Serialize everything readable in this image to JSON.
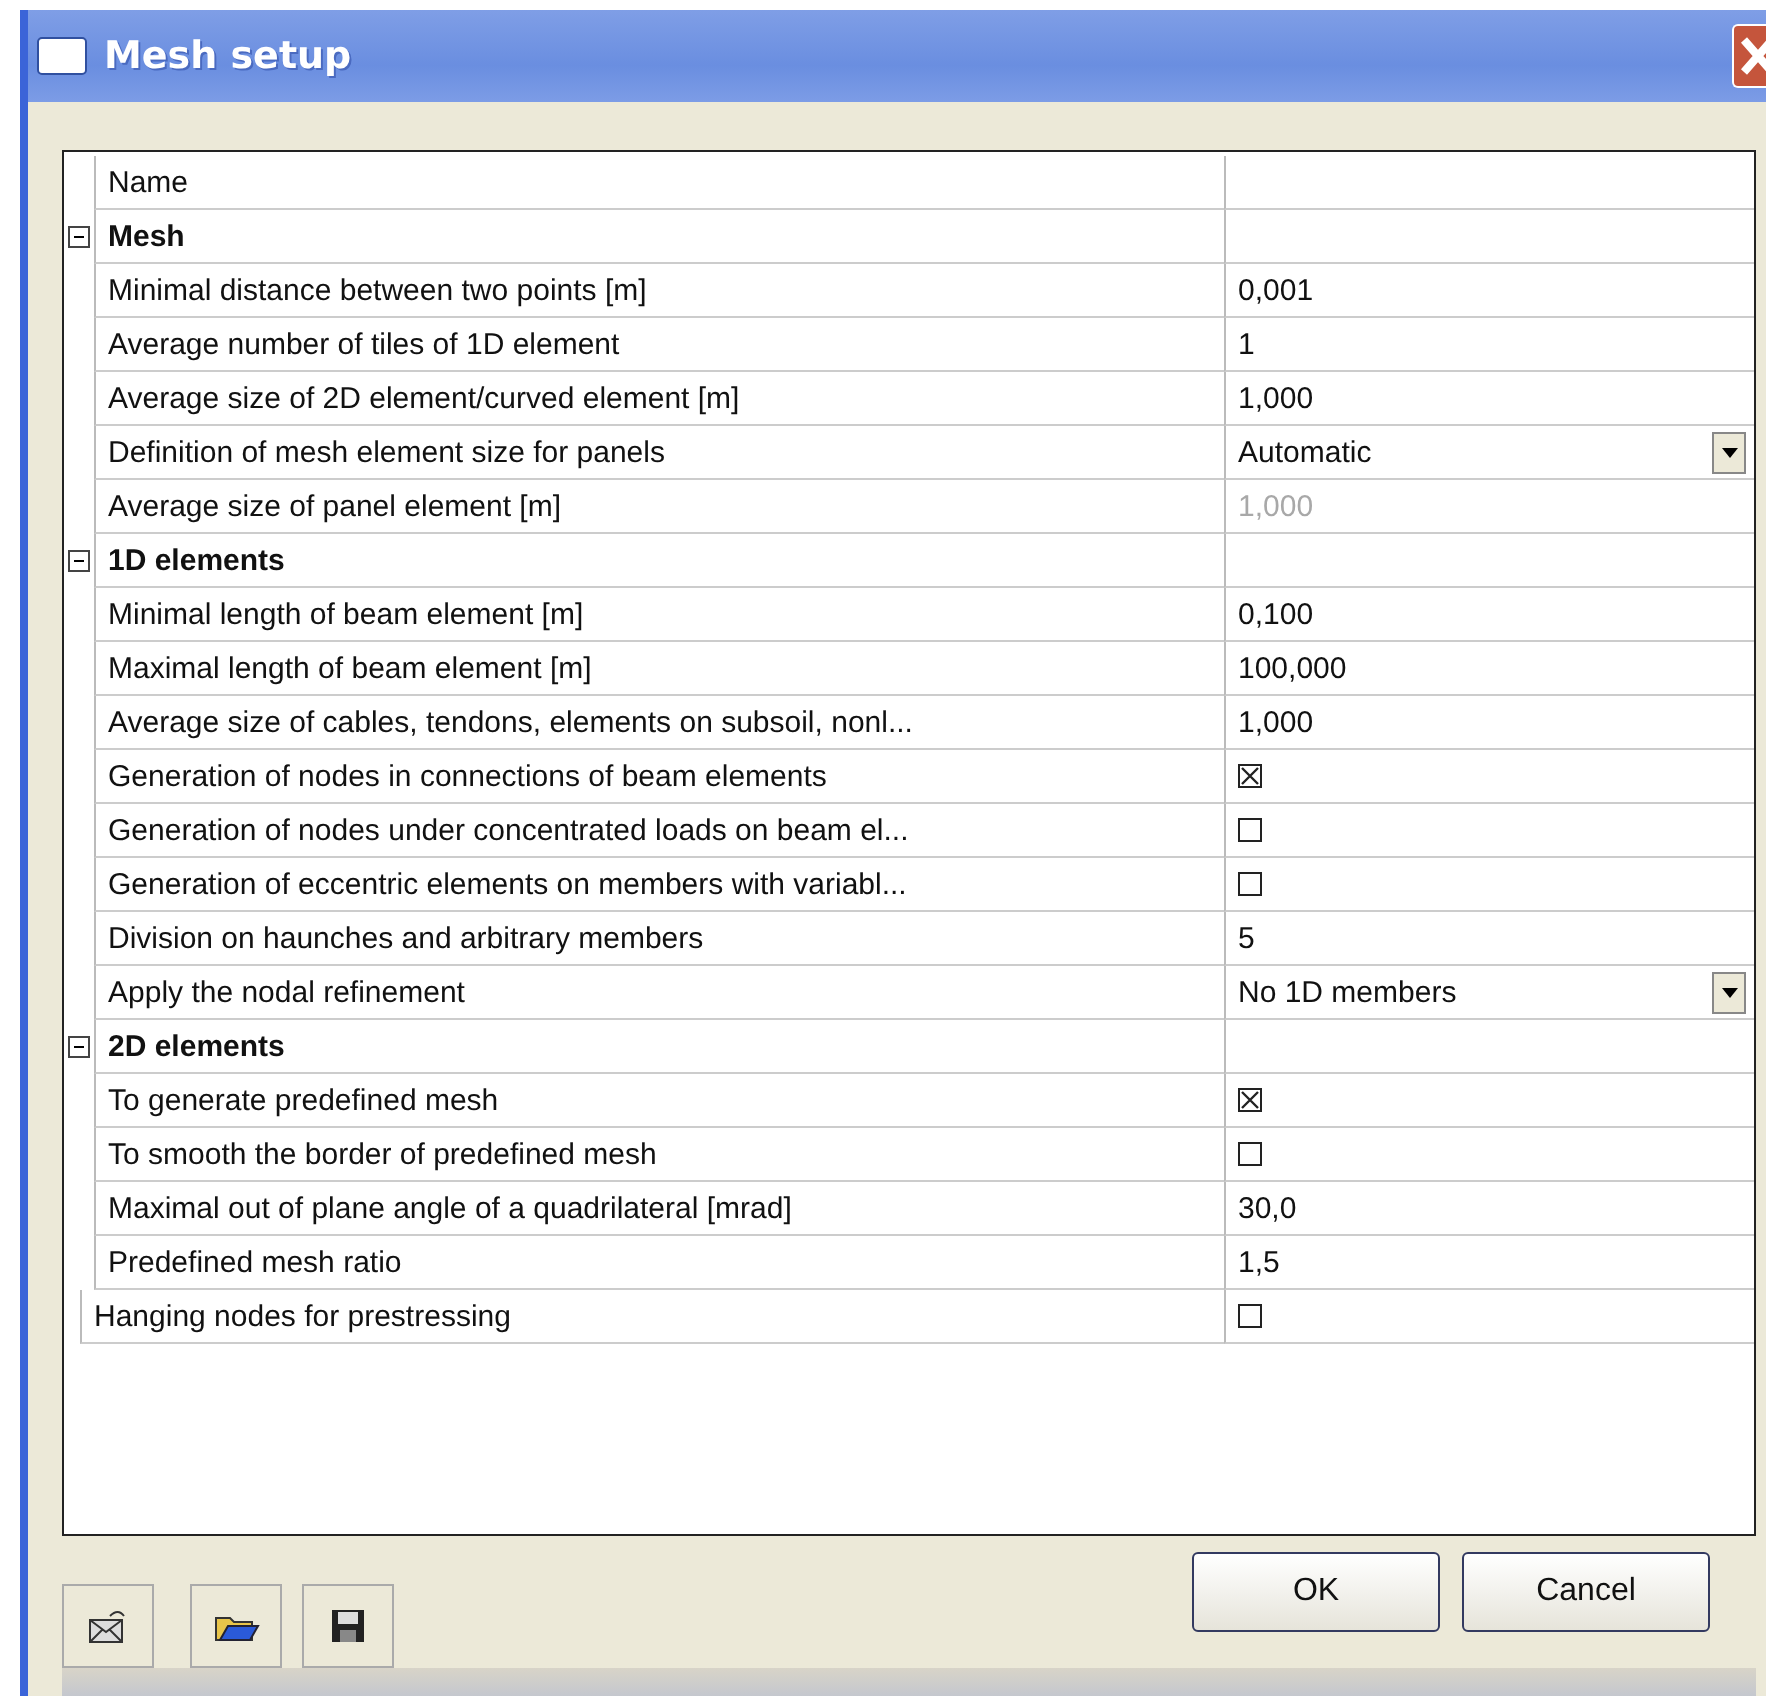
{
  "window": {
    "title": "Mesh setup"
  },
  "grid": {
    "header": "Name",
    "rows": [
      {
        "kind": "group",
        "label": "Mesh",
        "expanded": true,
        "children": [
          {
            "kind": "text",
            "label": "Minimal distance between two points [m]",
            "value": "0,001",
            "disabled": false
          },
          {
            "kind": "text",
            "label": "Average number of tiles of 1D element",
            "value": "1",
            "disabled": false
          },
          {
            "kind": "text",
            "label": "Average size of 2D element/curved element [m]",
            "value": "1,000",
            "disabled": false
          },
          {
            "kind": "dropdown",
            "label": "Definition of mesh element size for panels",
            "value": "Automatic"
          },
          {
            "kind": "text",
            "label": "Average size of panel element [m]",
            "value": "1,000",
            "disabled": true
          }
        ]
      },
      {
        "kind": "group",
        "label": "1D elements",
        "expanded": true,
        "children": [
          {
            "kind": "text",
            "label": "Minimal length of beam element [m]",
            "value": "0,100",
            "disabled": false
          },
          {
            "kind": "text",
            "label": "Maximal length of beam element [m]",
            "value": "100,000",
            "disabled": false
          },
          {
            "kind": "text",
            "label": "Average size of cables, tendons, elements on subsoil, nonl...",
            "value": "1,000",
            "disabled": false
          },
          {
            "kind": "checkbox",
            "label": "Generation of nodes in connections of beam elements",
            "checked": true
          },
          {
            "kind": "checkbox",
            "label": "Generation of nodes under concentrated loads on beam el...",
            "checked": false
          },
          {
            "kind": "checkbox",
            "label": "Generation of eccentric elements on members with variabl...",
            "checked": false
          },
          {
            "kind": "text",
            "label": "Division on haunches and arbitrary members",
            "value": "5",
            "disabled": false
          },
          {
            "kind": "dropdown",
            "label": "Apply the nodal refinement",
            "value": "No 1D members"
          }
        ]
      },
      {
        "kind": "group",
        "label": "2D elements",
        "expanded": true,
        "children": [
          {
            "kind": "checkbox",
            "label": "To generate predefined mesh",
            "checked": true
          },
          {
            "kind": "checkbox",
            "label": "To smooth the border of predefined mesh",
            "checked": false
          },
          {
            "kind": "text",
            "label": "Maximal out of plane angle of a quadrilateral [mrad]",
            "value": "30,0",
            "disabled": false
          },
          {
            "kind": "text",
            "label": "Predefined mesh ratio",
            "value": "1,5",
            "disabled": false
          }
        ]
      },
      {
        "kind": "checkbox",
        "label": "Hanging nodes for prestressing",
        "checked": false
      }
    ]
  },
  "buttons": [
    "OK",
    "Cancel"
  ]
}
